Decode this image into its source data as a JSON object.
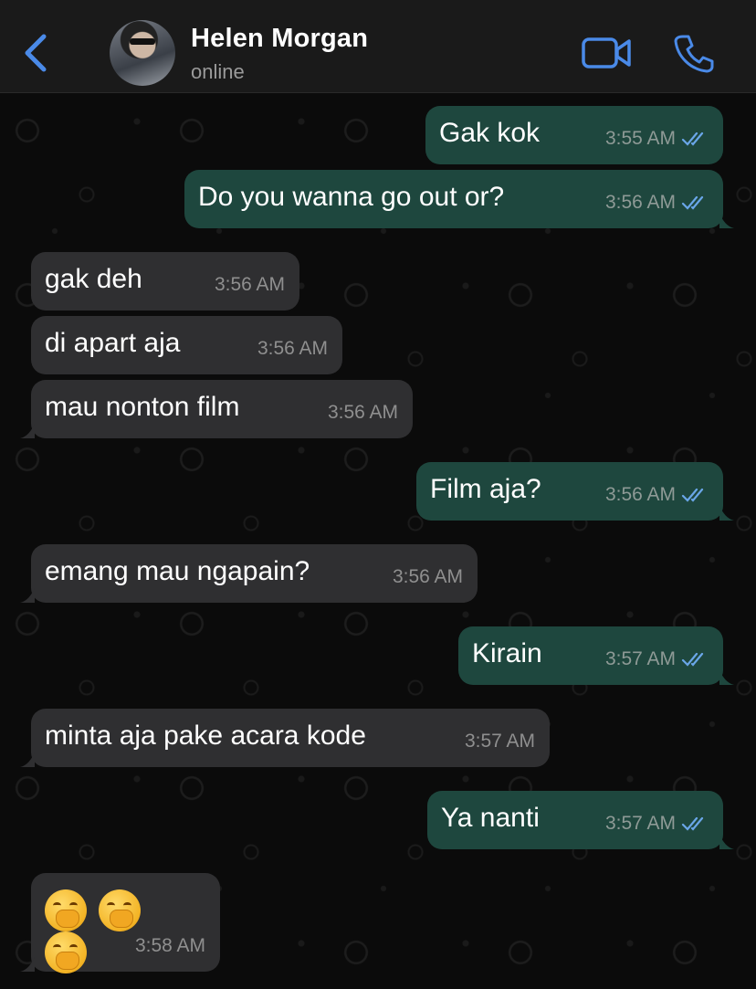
{
  "header": {
    "contact_name": "Helen Morgan",
    "status": "online",
    "accent_color": "#4a8ae8",
    "icons": {
      "back": "chevron-left-icon",
      "video": "video-camera-icon",
      "call": "phone-icon"
    }
  },
  "messages": [
    {
      "direction": "out",
      "text": "Gak kok",
      "time": "3:55 AM",
      "read": true
    },
    {
      "direction": "out",
      "text": "Do you wanna go out or?",
      "time": "3:56 AM",
      "read": true
    },
    {
      "direction": "in",
      "text": "gak deh",
      "time": "3:56 AM"
    },
    {
      "direction": "in",
      "text": "di apart aja",
      "time": "3:56 AM"
    },
    {
      "direction": "in",
      "text": "mau nonton film",
      "time": "3:56 AM"
    },
    {
      "direction": "out",
      "text": "Film aja?",
      "time": "3:56 AM",
      "read": true
    },
    {
      "direction": "in",
      "text": "emang mau ngapain?",
      "time": "3:56 AM"
    },
    {
      "direction": "out",
      "text": "Kirain",
      "time": "3:57 AM",
      "read": true
    },
    {
      "direction": "in",
      "text": "minta aja pake acara kode",
      "time": "3:57 AM"
    },
    {
      "direction": "out",
      "text": "Ya nanti",
      "time": "3:57 AM",
      "read": true
    },
    {
      "direction": "in",
      "emojis": [
        "yawning-face",
        "yawning-face",
        "yawning-face"
      ],
      "time": "3:58 AM"
    }
  ],
  "colors": {
    "outgoing_bubble": "#1e473e",
    "incoming_bubble": "#2f2f31",
    "read_ticks": "#6aa6e8",
    "background": "#0b0b0b"
  }
}
